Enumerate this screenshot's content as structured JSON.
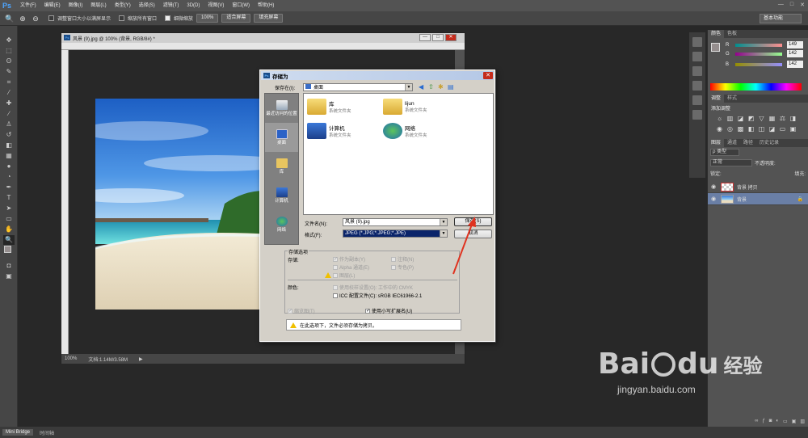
{
  "app": {
    "logo": "Ps"
  },
  "menu": [
    "文件(F)",
    "编辑(E)",
    "图像(I)",
    "图层(L)",
    "类型(Y)",
    "选择(S)",
    "滤镜(T)",
    "3D(D)",
    "视图(V)",
    "窗口(W)",
    "帮助(H)"
  ],
  "window_controls": [
    "—",
    "□",
    "✕"
  ],
  "options_bar": {
    "check1_label": "调整窗口大小以满屏显示",
    "check2_label": "缩放所有窗口",
    "check3_label": "细微缩放",
    "zoom_btn": "100%",
    "fit_btn": "适合屏幕",
    "fill_btn": "填充屏幕",
    "workspace": "基本功能"
  },
  "document": {
    "title": "风景 (9).jpg @ 100% (背景, RGB/8#) *",
    "zoom": "100%",
    "doc_size": "文档:1.14M/3.58M"
  },
  "color_panel": {
    "tabs": [
      "颜色",
      "色板"
    ],
    "r_label": "R",
    "g_label": "G",
    "b_label": "B",
    "r": "149",
    "g": "142",
    "b": "142"
  },
  "adjust_panel": {
    "tabs": [
      "调整",
      "样式"
    ],
    "title": "添加调整"
  },
  "layers_panel": {
    "tabs": [
      "图层",
      "通道",
      "路径",
      "历史记录"
    ],
    "filter": "ρ 类型",
    "blend_mode": "正常",
    "opacity_label": "不透明度:",
    "lock_label": "锁定:",
    "fill_label": "填充:",
    "layers": [
      {
        "name": "背景 拷贝"
      },
      {
        "name": "背景"
      }
    ]
  },
  "bottom_tabs": [
    "Mini Bridge",
    "时间轴"
  ],
  "dialog": {
    "title": "存储为",
    "save_in_label": "保存在(I):",
    "save_in_value": "桌面",
    "places": [
      "最近访问的位置",
      "桌面",
      "库",
      "计算机",
      "网络"
    ],
    "files": [
      {
        "name": "库",
        "sub": "系统文件夹"
      },
      {
        "name": "lijun",
        "sub": "系统文件夹"
      },
      {
        "name": "计算机",
        "sub": "系统文件夹"
      },
      {
        "name": "网络",
        "sub": "系统文件夹"
      }
    ],
    "filename_label": "文件名(N):",
    "filename_value": "风景 (9).jpg",
    "format_label": "格式(F):",
    "format_value": "JPEG (*.JPG;*.JPEG;*.JPE)",
    "save_btn": "保存(S)",
    "cancel_btn": "取消",
    "options_title": "存储选项",
    "store_label": "存储:",
    "opt_copy": "作为副本(Y)",
    "opt_notes": "注释(N)",
    "opt_alpha": "Alpha 通道(E)",
    "opt_spot": "专色(P)",
    "opt_layers": "图层(L)",
    "color_label": "颜色:",
    "opt_proof": "使用校样设置(O): 工作中的 CMYK",
    "opt_icc": "ICC 配置文件(C): sRGB IEC61966-2.1",
    "opt_thumb": "缩览图(T)",
    "opt_lower": "使用小写扩展名(U)",
    "warning": "在此选项下，文件必须存储为拷贝。"
  },
  "watermark": {
    "brand": "Bai",
    "brand2": "du",
    "cn": "经验",
    "url": "jingyan.baidu.com"
  }
}
